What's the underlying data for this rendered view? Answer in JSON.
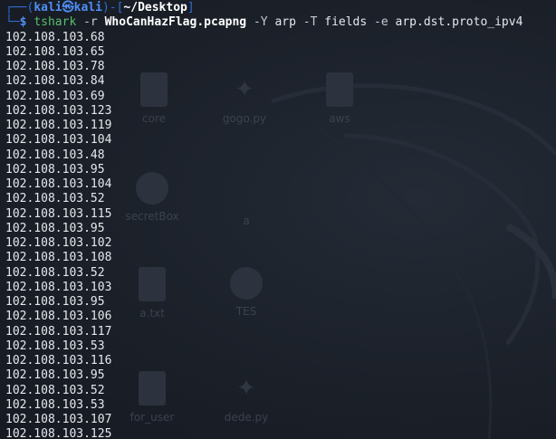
{
  "prompt": {
    "box_top": "┌──(",
    "user": "kali㉿kali",
    "mid": ")-[",
    "path": "~/Desktop",
    "end": "]",
    "box_bottom": "└─",
    "dollar": "$"
  },
  "command": {
    "name": "tshark",
    "flag_r": "-r",
    "file": "WhoCanHazFlag.pcapng",
    "flag_y": "-Y",
    "filter": "arp",
    "flag_t": "-T",
    "format": "fields",
    "flag_e": "-e",
    "field": "arp.dst.proto_ipv4"
  },
  "output": [
    "102.108.103.68",
    "102.108.103.65",
    "102.108.103.78",
    "102.108.103.84",
    "102.108.103.69",
    "102.108.103.123",
    "102.108.103.119",
    "102.108.103.104",
    "102.108.103.48",
    "102.108.103.95",
    "102.108.103.104",
    "102.108.103.52",
    "102.108.103.115",
    "102.108.103.95",
    "102.108.103.102",
    "102.108.103.108",
    "102.108.103.52",
    "102.108.103.103",
    "102.108.103.95",
    "102.108.103.106",
    "102.108.103.117",
    "102.108.103.53",
    "102.108.103.116",
    "102.108.103.95",
    "102.108.103.52",
    "102.108.103.53",
    "102.108.103.107",
    "102.108.103.125"
  ],
  "desktop_icons": [
    {
      "label": "core",
      "icon": "file-icon"
    },
    {
      "label": "gogo.py",
      "icon": "python-file-icon"
    },
    {
      "label": "aws",
      "icon": "file-icon"
    },
    {
      "label": "secretBox",
      "icon": "gear-icon"
    },
    {
      "label": "a",
      "icon": "file-icon"
    },
    {
      "label": "a.txt",
      "icon": "file-icon"
    },
    {
      "label": "TES",
      "icon": "gear-icon"
    },
    {
      "label": "for_user",
      "icon": "file-icon"
    },
    {
      "label": "dede.py",
      "icon": "python-file-icon"
    }
  ],
  "colors": {
    "background": "#1b2029",
    "prompt_blue": "#4f8ff7",
    "command_green": "#58c06a",
    "text": "#e6e8ec"
  }
}
